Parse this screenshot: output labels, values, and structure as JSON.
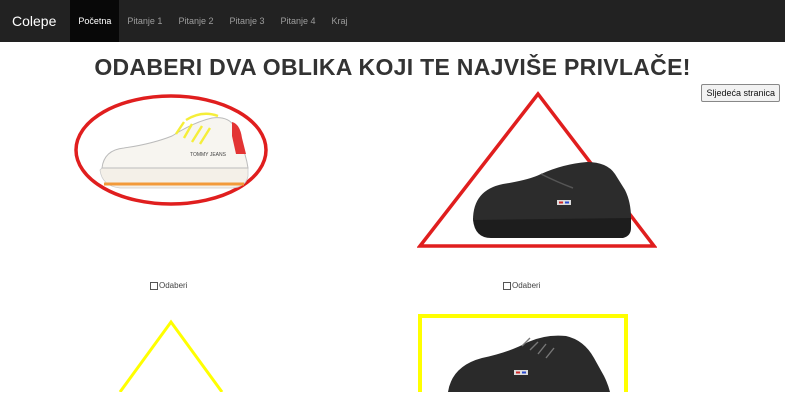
{
  "nav": {
    "brand": "Colepe",
    "items": [
      {
        "label": "Početna",
        "active": true
      },
      {
        "label": "Pitanje 1"
      },
      {
        "label": "Pitanje 2"
      },
      {
        "label": "Pitanje 3"
      },
      {
        "label": "Pitanje 4"
      },
      {
        "label": "Kraj"
      }
    ]
  },
  "page": {
    "title": "ODABERI DVA OBLIKA KOJI TE NAJVIŠE PRIVLAČE!",
    "next_button": "Sljedeća stranica"
  },
  "options": [
    {
      "shape": "ellipse",
      "color": "#e01e1e",
      "shoe": "white sneaker",
      "checkbox_label": "Odaberi"
    },
    {
      "shape": "triangle",
      "color": "#e01e1e",
      "shoe": "black sneaker",
      "checkbox_label": "Odaberi"
    },
    {
      "shape": "triangle",
      "color": "#ffff00",
      "shoe": "",
      "checkbox_label": ""
    },
    {
      "shape": "rectangle",
      "color": "#ffff00",
      "shoe": "black sneaker",
      "checkbox_label": ""
    }
  ]
}
